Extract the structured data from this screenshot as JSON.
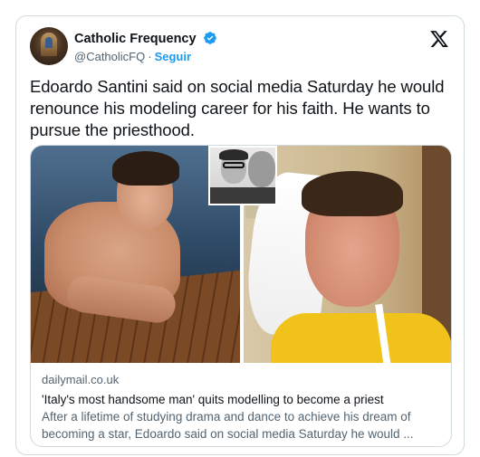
{
  "tweet": {
    "author_name": "Catholic Frequency",
    "handle": "@CatholicFQ",
    "separator": "·",
    "follow_label": "Seguir",
    "text": "Edoardo Santini said on social media Saturday he would renounce his modeling career for his faith.  He wants to pursue the priesthood."
  },
  "link_card": {
    "domain": "dailymail.co.uk",
    "title": "'Italy's most handsome man' quits modelling to become a priest",
    "description": "After a lifetime of studying drama and dance to achieve his dream of becoming a star, Edoardo said on social media Saturday he would ..."
  },
  "icons": {
    "verified": "verified-badge-icon",
    "platform_logo": "x-logo-icon"
  },
  "colors": {
    "accent": "#1d9bf0",
    "text_primary": "#0f1419",
    "text_secondary": "#536471",
    "border": "#cfd9de"
  }
}
